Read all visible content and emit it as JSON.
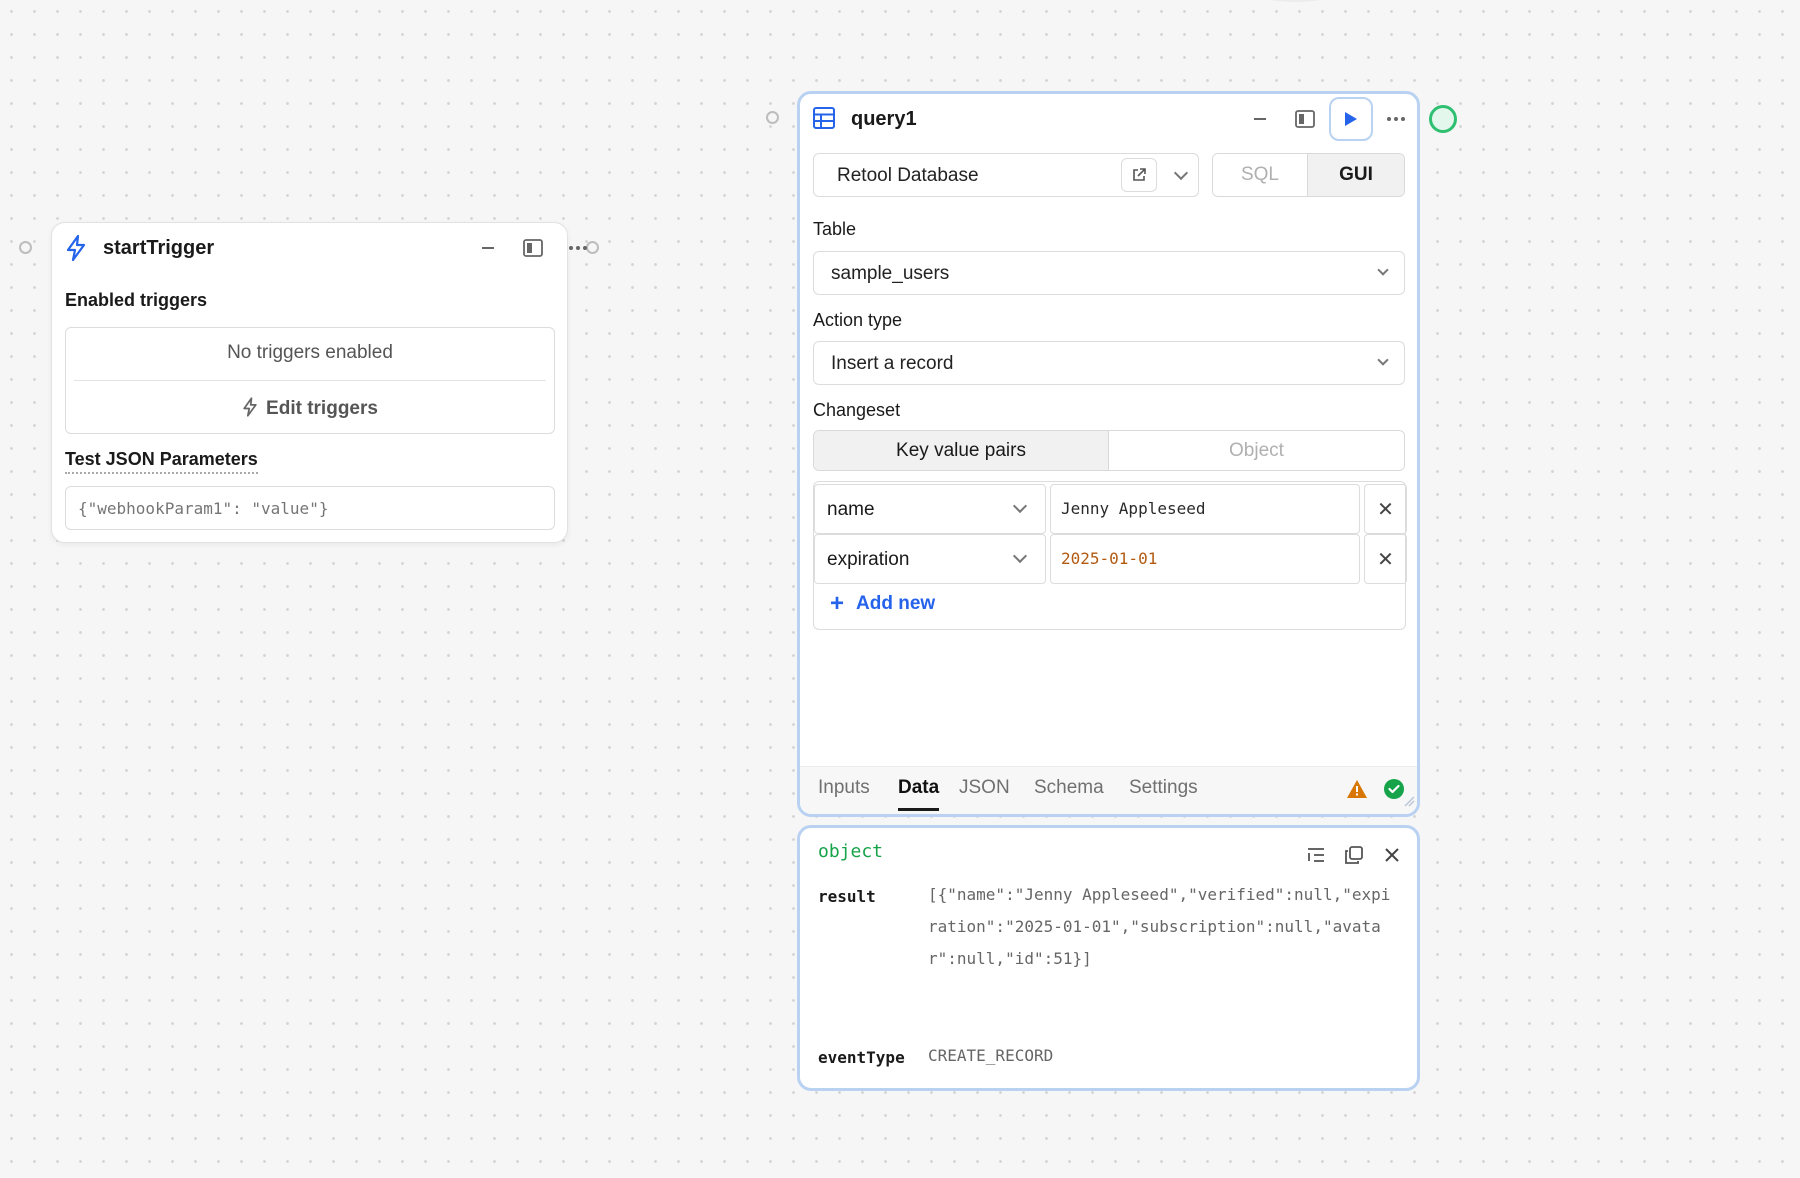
{
  "trigger_block": {
    "title": "startTrigger",
    "icon": "lightning-icon",
    "enabled_label": "Enabled triggers",
    "empty_text": "No triggers enabled",
    "edit_label": "Edit triggers",
    "test_label": "Test JSON Parameters",
    "test_placeholder": "{\"webhookParam1\": \"value\"}"
  },
  "query_block": {
    "title": "query1",
    "icon": "table-icon",
    "resource": "Retool Database",
    "mode_tabs": [
      "SQL",
      "GUI"
    ],
    "active_mode": "GUI",
    "table_label": "Table",
    "table_value": "sample_users",
    "action_label": "Action type",
    "action_value": "Insert a record",
    "changeset_label": "Changeset",
    "changeset_tabs": [
      "Key value pairs",
      "Object"
    ],
    "rows": [
      {
        "key": "name",
        "value": "Jenny Appleseed",
        "value_color": "#2a2a2a"
      },
      {
        "key": "expiration",
        "value": "2025-01-01",
        "value_color": "#b35a12"
      }
    ],
    "add_new": "Add new",
    "bottom_tabs": [
      "Inputs",
      "Data",
      "JSON",
      "Schema",
      "Settings"
    ],
    "active_bottom_tab": "Data",
    "colors": {
      "accent": "#2563eb",
      "warning": "#d97706",
      "success": "#16a34a"
    }
  },
  "result_block": {
    "type_label": "object",
    "result_key": "result",
    "result_value": "[{\"name\":\"Jenny Appleseed\",\"verified\":null,\"expiration\":\"2025-01-01\",\"subscription\":null,\"avatar\":null,\"id\":51}]",
    "event_key": "eventType",
    "event_value": "CREATE_RECORD"
  }
}
